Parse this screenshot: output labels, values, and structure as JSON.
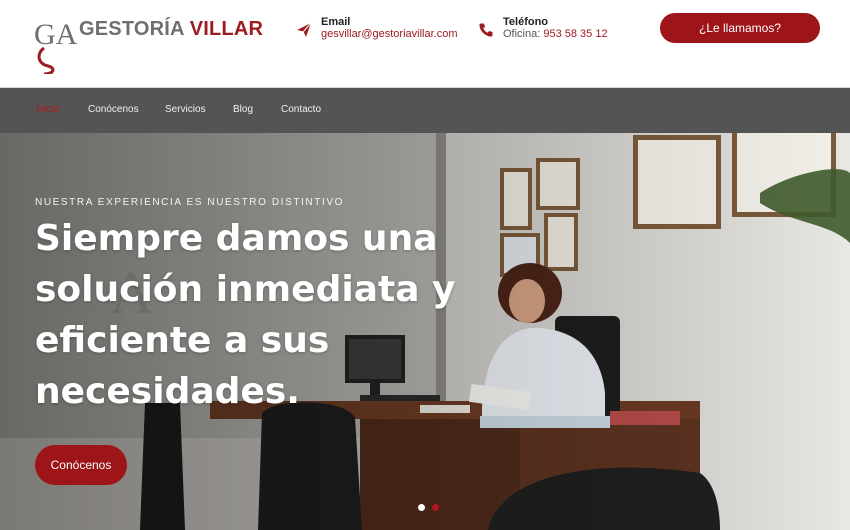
{
  "logo": {
    "word1": "GESTORÍA",
    "word2": "VILLAR",
    "monogram": "GA"
  },
  "contact": {
    "email": {
      "label": "Email",
      "value": "gesvillar@gestoriavillar.com",
      "icon": "paper-plane-icon"
    },
    "phone": {
      "label": "Teléfono",
      "prefix": "Oficina:",
      "value": "953 58 35 12",
      "icon": "phone-icon"
    }
  },
  "cta_label": "¿Le llamamos?",
  "nav": [
    "Inicio",
    "Conócenos",
    "Servicios",
    "Blog",
    "Contacto"
  ],
  "nav_active": "Inicio",
  "hero": {
    "eyebrow": "NUESTRA EXPERIENCIA ES NUESTRO DISTINTIVO",
    "headline_lines": [
      "Siempre damos una",
      "solución inmediata y",
      "eficiente a sus",
      "necesidades."
    ],
    "button_label": "Conócenos",
    "slide_count": 2,
    "active_slide": 1
  },
  "colors": {
    "brand_red": "#9d1419",
    "nav_bg": "#545454",
    "logo_gray": "#6f6f6f"
  }
}
